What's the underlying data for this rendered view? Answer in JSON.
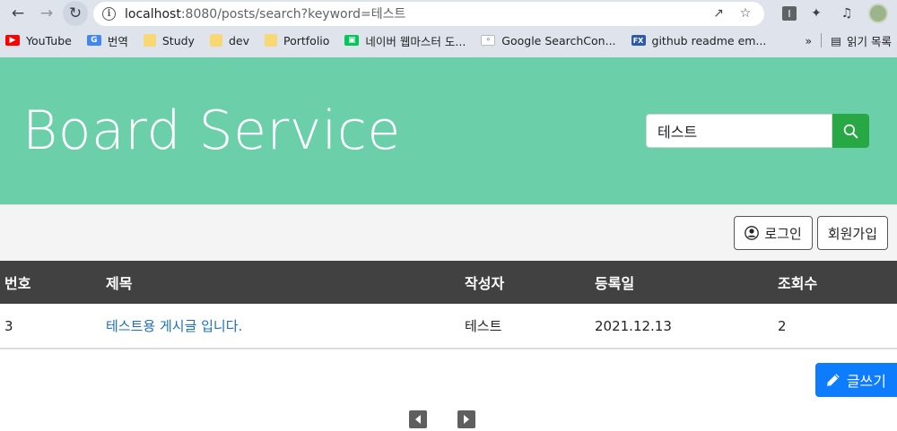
{
  "browser": {
    "url_host": "localhost",
    "url_path": ":8080/posts/search?keyword=테스트",
    "bookmarks": [
      {
        "label": "YouTube",
        "icon": "youtube-icon"
      },
      {
        "label": "번역",
        "icon": "translate-icon"
      },
      {
        "label": "Study",
        "icon": "folder-icon"
      },
      {
        "label": "dev",
        "icon": "folder-icon"
      },
      {
        "label": "Portfolio",
        "icon": "folder-icon"
      },
      {
        "label": "네이버 웹마스터 도...",
        "icon": "naver-icon"
      },
      {
        "label": "Google SearchCon...",
        "icon": "google-search-console-icon"
      },
      {
        "label": "github readme em...",
        "icon": "fx-icon"
      }
    ],
    "more_label": "»",
    "reading_list_label": "읽기 목록"
  },
  "header": {
    "brand": "Board Service",
    "search_value": "테스트"
  },
  "auth": {
    "login_label": "로그인",
    "signup_label": "회원가입"
  },
  "table": {
    "headers": [
      "번호",
      "제목",
      "작성자",
      "등록일",
      "조회수"
    ],
    "rows": [
      {
        "no": "3",
        "title": "테스트용 게시글 입니다.",
        "author": "테스트",
        "date": "2021.12.13",
        "views": "2"
      }
    ]
  },
  "write_label": "글쓰기",
  "colors": {
    "header_bg": "#6bcfaa",
    "search_button": "#28a745",
    "write_button": "#0d7cff",
    "table_head": "#414141",
    "link": "#1a6fc2"
  }
}
